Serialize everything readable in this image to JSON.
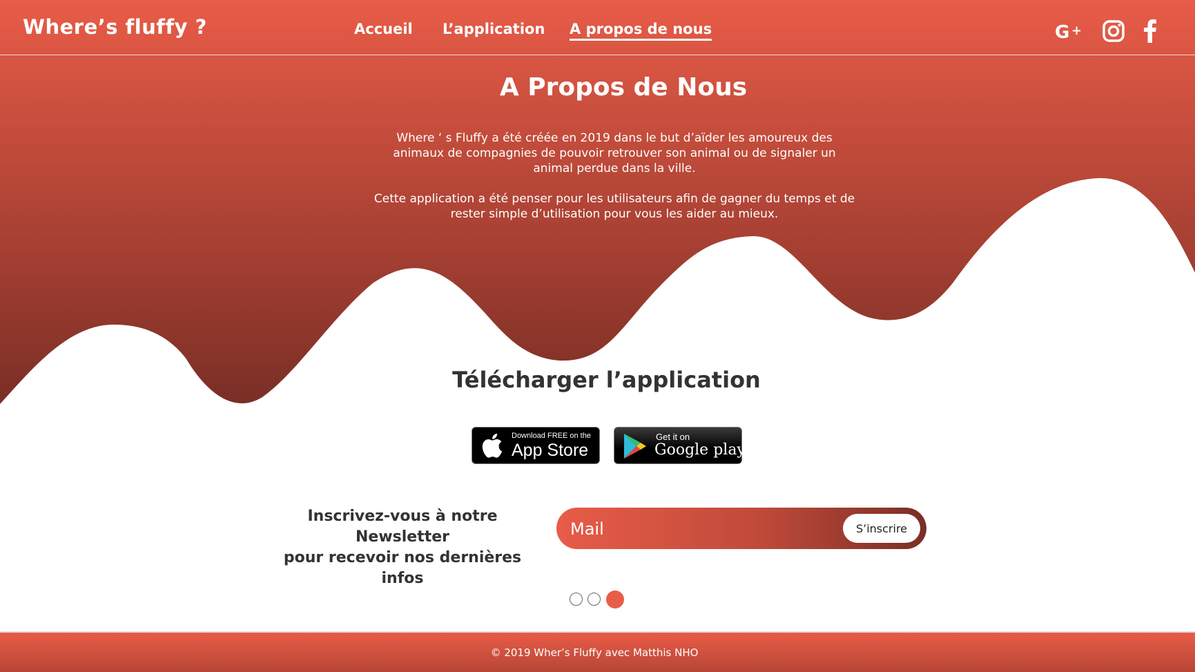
{
  "header": {
    "logo": "Where’s fluffy ?",
    "nav": [
      {
        "label": "Accueil",
        "active": false
      },
      {
        "label": "L’application",
        "active": false
      },
      {
        "label": "A propos de nous",
        "active": true
      }
    ],
    "social": [
      "google-plus-icon",
      "instagram-icon",
      "facebook-icon"
    ]
  },
  "about": {
    "title": "A Propos de Nous",
    "paragraph1": "Where ‘ s Fluffy a été créée en 2019 dans le but d’aïder les amoureux des animaux de compagnies de pouvoir retrouver son animal ou de signaler un animal perdue dans la ville.",
    "paragraph2": "Cette application a été penser pour les utilisateurs afin de gagner du temps et de rester simple d’utilisation pour vous les aider au mieux."
  },
  "download": {
    "title": "Télécharger l’application",
    "appstore": {
      "small": "Download FREE on the",
      "big": "App Store",
      "icon": "apple-icon"
    },
    "googleplay": {
      "small": "Get it on",
      "big": "Google play",
      "icon": "google-play-icon"
    }
  },
  "newsletter": {
    "line1": "Inscrivez-vous à notre Newsletter",
    "line2": "pour recevoir nos dernières infos",
    "placeholder": "Mail",
    "button": "S’inscrire"
  },
  "carousel": {
    "count": 3,
    "active": 3
  },
  "footer": {
    "copyright": "© 2019 Wher’s Fluffy avec Matthis NHO"
  },
  "colors": {
    "primary": "#e85c48",
    "dark": "#7a2e26",
    "text": "#333333"
  }
}
